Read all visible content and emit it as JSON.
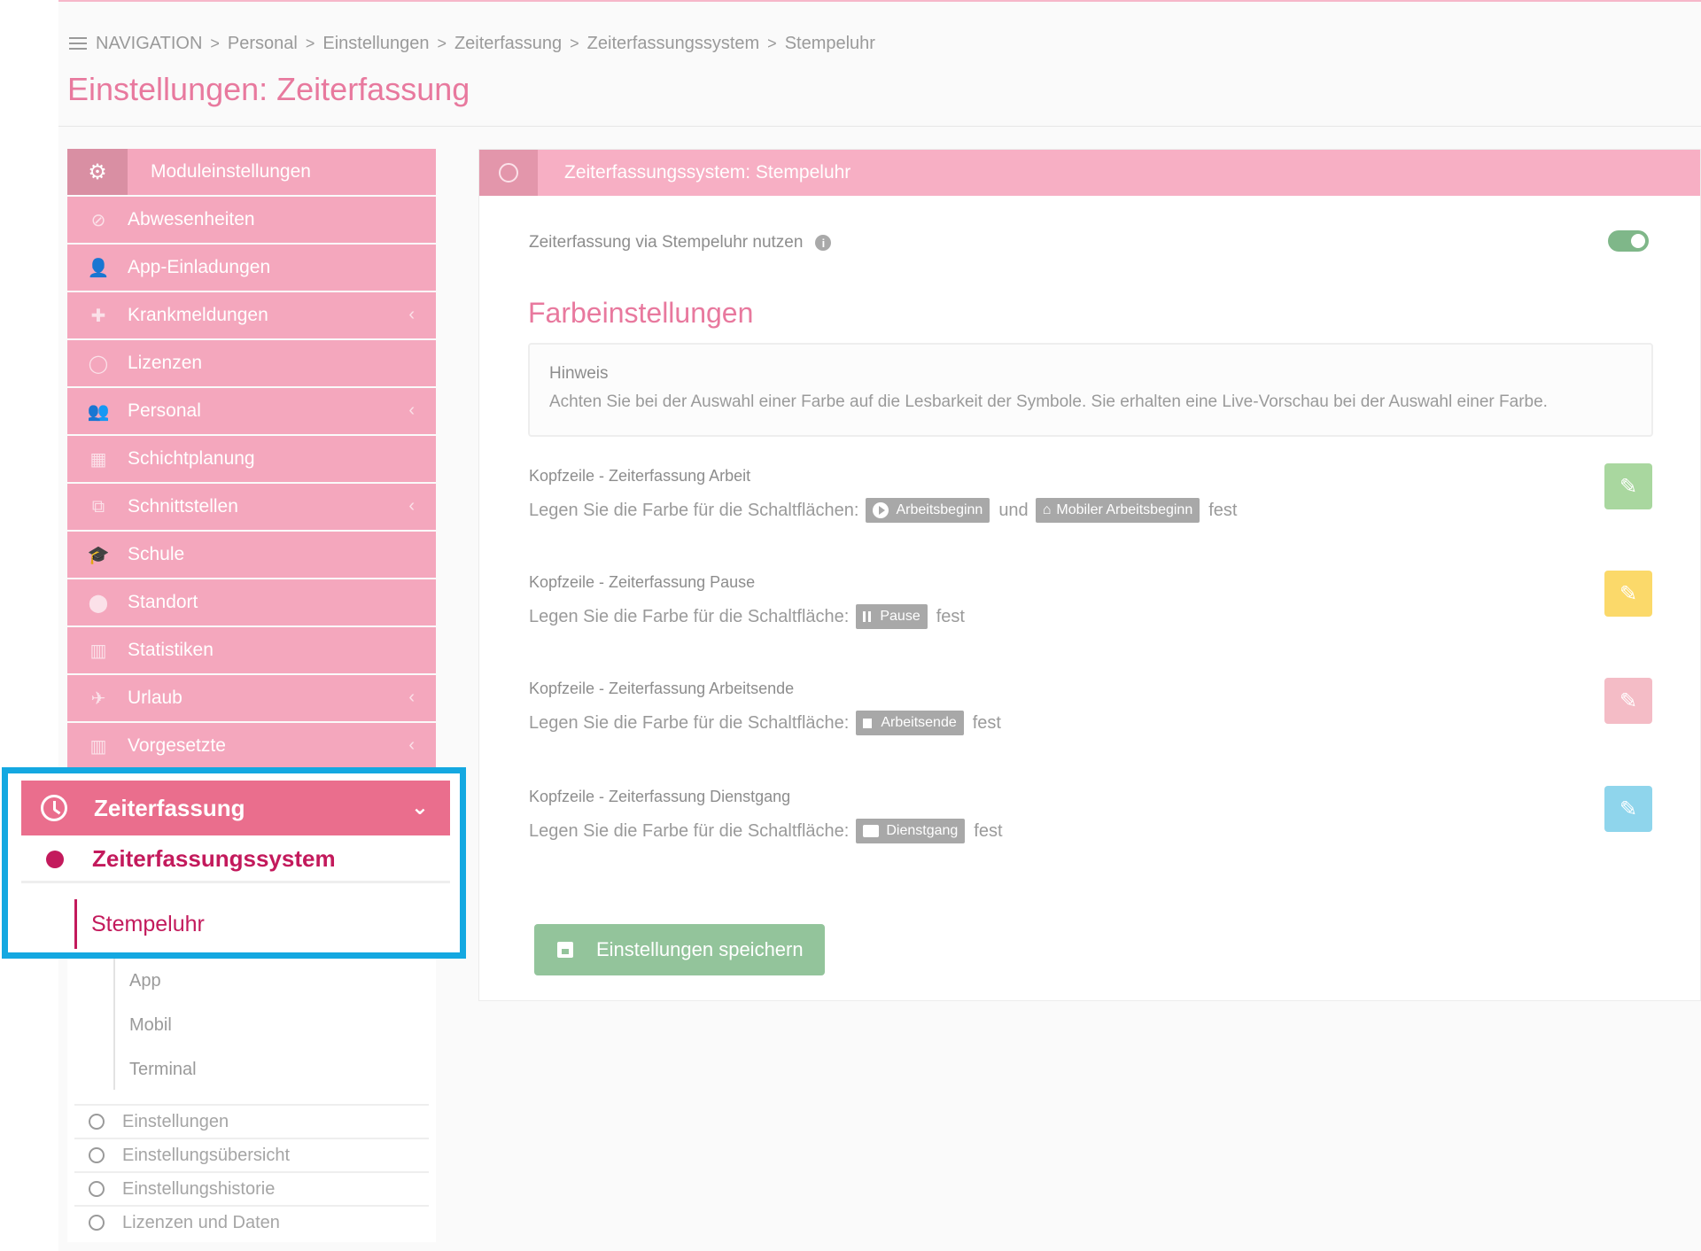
{
  "breadcrumb": {
    "items": [
      "NAVIGATION",
      "Personal",
      "Einstellungen",
      "Zeiterfassung",
      "Zeiterfassungssystem",
      "Stempeluhr"
    ],
    "separator": ">"
  },
  "page_title": "Einstellungen: Zeiterfassung",
  "sidebar": {
    "header": "Moduleinstellungen",
    "items": [
      {
        "label": "Abwesenheiten",
        "icon": "ban-icon",
        "expandable": false
      },
      {
        "label": "App-Einladungen",
        "icon": "user-icon",
        "expandable": false
      },
      {
        "label": "Krankmeldungen",
        "icon": "medical-icon",
        "expandable": true
      },
      {
        "label": "Lizenzen",
        "icon": "circle-icon",
        "expandable": false
      },
      {
        "label": "Personal",
        "icon": "group-icon",
        "expandable": true
      },
      {
        "label": "Schichtplanung",
        "icon": "calendar-icon",
        "expandable": false
      },
      {
        "label": "Schnittstellen",
        "icon": "network-icon",
        "expandable": true
      },
      {
        "label": "Schule",
        "icon": "graduation-icon",
        "expandable": false
      },
      {
        "label": "Standort",
        "icon": "location-pin-icon",
        "expandable": false
      },
      {
        "label": "Statistiken",
        "icon": "chart-icon",
        "expandable": false
      },
      {
        "label": "Urlaub",
        "icon": "plane-icon",
        "expandable": true
      },
      {
        "label": "Vorgesetzte",
        "icon": "chart-icon",
        "expandable": true
      }
    ],
    "active_group": {
      "label": "Zeiterfassung",
      "system": "Zeiterfassungssystem",
      "active_sub": "Stempeluhr",
      "subs": [
        "App",
        "Mobil",
        "Terminal"
      ]
    },
    "radio_items": [
      "Einstellungen",
      "Einstellungsübersicht",
      "Einstellungshistorie",
      "Lizenzen und Daten"
    ]
  },
  "panel": {
    "header": "Zeiterfassungssystem: Stempeluhr",
    "toggle_label": "Zeiterfassung via Stempeluhr nutzen",
    "toggle_on": true,
    "section_title": "Farbeinstellungen",
    "hint_title": "Hinweis",
    "hint_text": "Achten Sie bei der Auswahl einer Farbe auf die Lesbarkeit der Symbole. Sie erhalten eine Live-Vorschau bei der Auswahl einer Farbe.",
    "rows": [
      {
        "title": "Kopfzeile - Zeiterfassung Arbeit",
        "desc_prefix": "Legen Sie die Farbe für die Schaltflächen:",
        "chip1": "Arbeitsbeginn",
        "connector": "und",
        "chip2": "Mobiler Arbeitsbeginn",
        "desc_suffix": "fest",
        "color": "#a9d79f"
      },
      {
        "title": "Kopfzeile - Zeiterfassung Pause",
        "desc_prefix": "Legen Sie die Farbe für die Schaltfläche:",
        "chip1": "Pause",
        "desc_suffix": "fest",
        "color": "#fbd96a"
      },
      {
        "title": "Kopfzeile - Zeiterfassung Arbeitsende",
        "desc_prefix": "Legen Sie die Farbe für die Schaltfläche:",
        "chip1": "Arbeitsende",
        "desc_suffix": "fest",
        "color": "#f4bcc6"
      },
      {
        "title": "Kopfzeile - Zeiterfassung Dienstgang",
        "desc_prefix": "Legen Sie die Farbe für die Schaltfläche:",
        "chip1": "Dienstgang",
        "desc_suffix": "fest",
        "color": "#8fd5ec"
      }
    ],
    "save_label": "Einstellungen speichern"
  },
  "colors": {
    "accent_pink": "#e8799e",
    "active_magenta": "#c31a5c",
    "highlight_frame": "#14a8e1",
    "save_green": "#93c49b"
  }
}
